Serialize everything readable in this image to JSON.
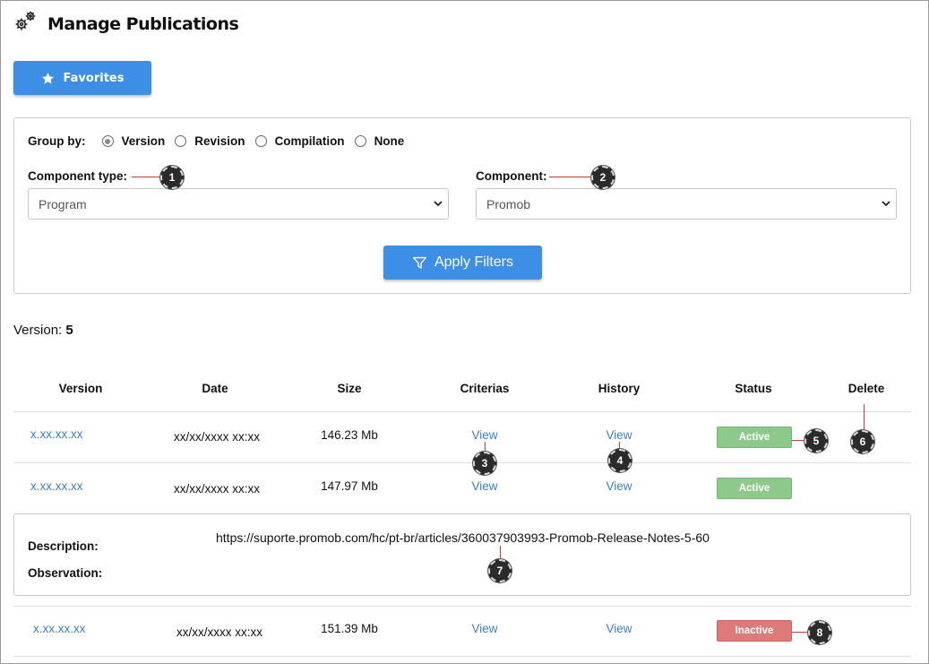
{
  "header": {
    "title": "Manage Publications",
    "icon": "gears-icon"
  },
  "favorites_button": {
    "label": "Favorites",
    "icon": "star-icon"
  },
  "filters": {
    "group_by_label": "Group by:",
    "group_options": [
      {
        "label": "Version",
        "checked": true
      },
      {
        "label": "Revision",
        "checked": false
      },
      {
        "label": "Compilation",
        "checked": false
      },
      {
        "label": "None",
        "checked": false
      }
    ],
    "component_type": {
      "label": "Component type:",
      "value": "Program"
    },
    "component": {
      "label": "Component:",
      "value": "Promob"
    },
    "apply_button": {
      "label": "Apply Filters",
      "icon": "filter-icon"
    }
  },
  "version_group": {
    "label": "Version:",
    "value": "5"
  },
  "table": {
    "columns": [
      "Version",
      "Date",
      "Size",
      "Criterias",
      "History",
      "Status",
      "Delete"
    ],
    "rows": [
      {
        "version": "x.xx.xx.xx",
        "date": "xx/xx/xxxx xx:xx",
        "size": "146.23 Mb",
        "criterias": "View",
        "history": "View",
        "status": "Active"
      },
      {
        "version": "x.xx.xx.xx",
        "date": "xx/xx/xxxx xx:xx",
        "size": "147.97 Mb",
        "criterias": "View",
        "history": "View",
        "status": "Active"
      },
      {
        "version": "x.xx.xx.xx",
        "date": "xx/xx/xxxx xx:xx",
        "size": "151.39 Mb",
        "criterias": "View",
        "history": "View",
        "status": "Inactive"
      }
    ]
  },
  "details": {
    "description_label": "Description:",
    "observation_label": "Observation:",
    "url": "https://suporte.promob.com/hc/pt-br/articles/360037903993-Promob-Release-Notes-5-60"
  },
  "markers": [
    "1",
    "2",
    "3",
    "4",
    "5",
    "6",
    "7",
    "8"
  ],
  "colors": {
    "primary": "#3d8fe6",
    "link": "#3b7fc4",
    "active": "#8cc98a",
    "inactive": "#dd7b7b",
    "marker_leader": "#d13a3a"
  }
}
